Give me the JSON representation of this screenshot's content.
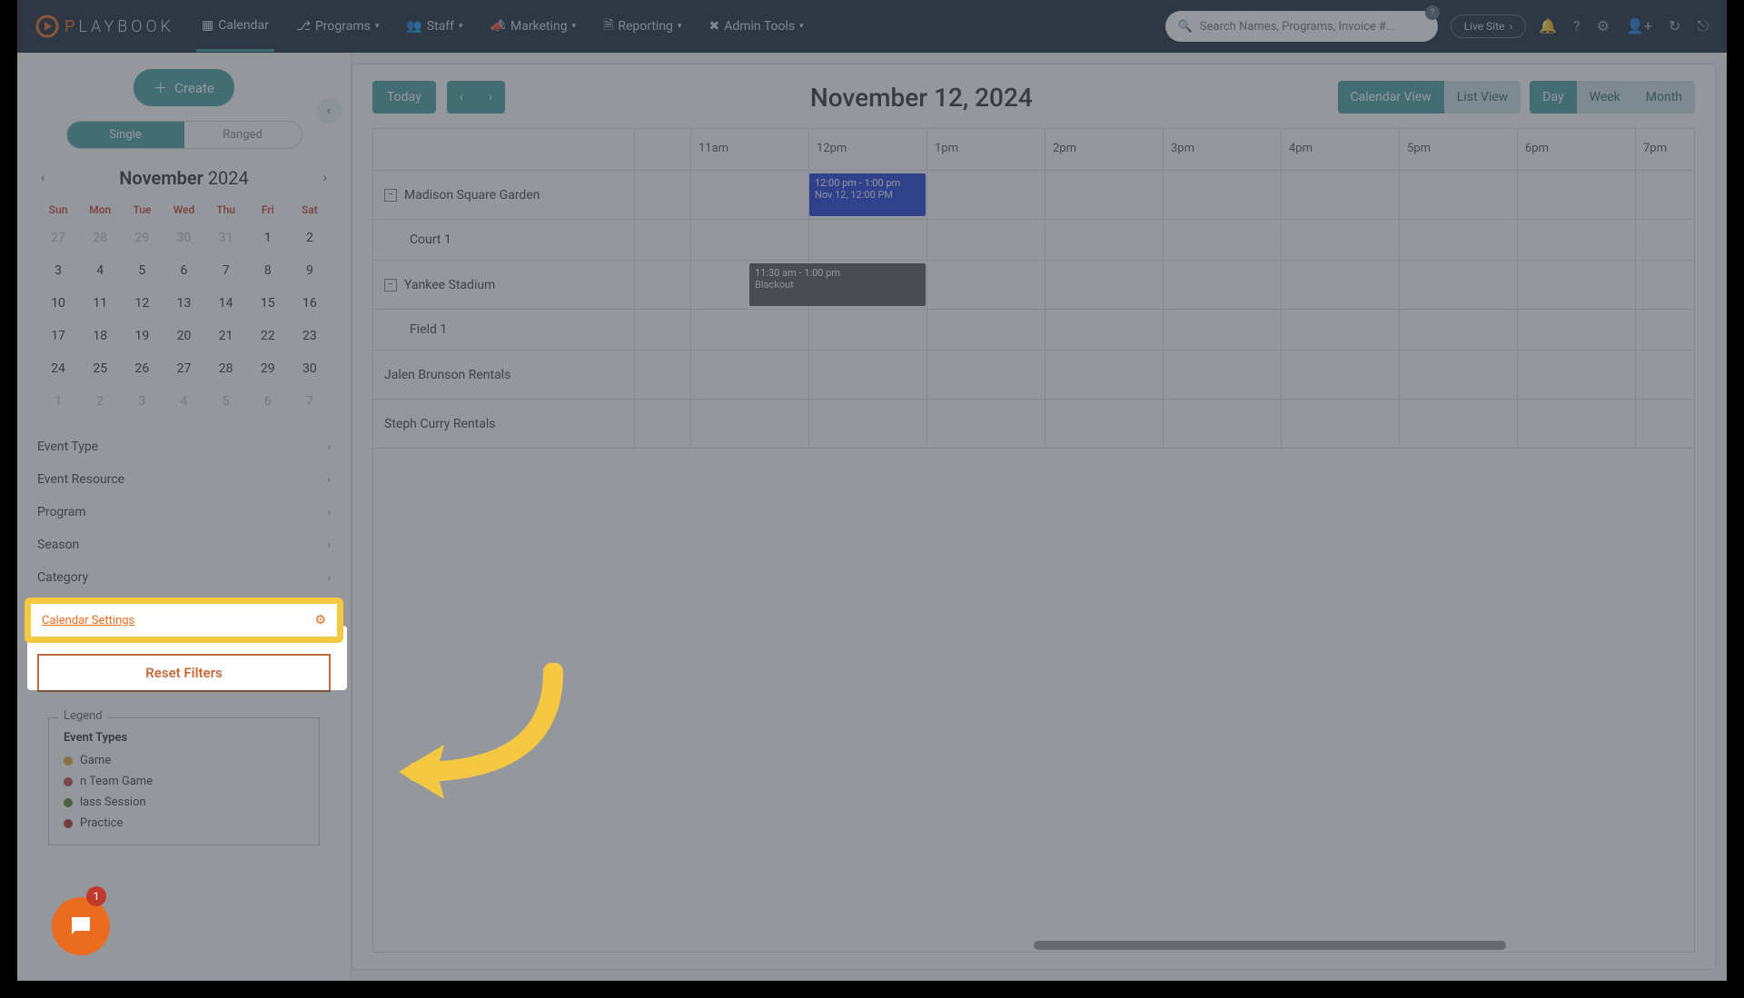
{
  "brand": {
    "name_part1": "P",
    "name_part2": "LAY",
    "name_part3": "BOOK"
  },
  "nav": {
    "calendar": "Calendar",
    "programs": "Programs",
    "staff": "Staff",
    "marketing": "Marketing",
    "reporting": "Reporting",
    "admin": "Admin Tools"
  },
  "search": {
    "placeholder": "Search Names, Programs, Invoice #..."
  },
  "live_site": "Live Site",
  "sidebar": {
    "create": "Create",
    "mode": {
      "single": "Single",
      "ranged": "Ranged"
    },
    "month_label_bold": "November",
    "month_label_year": " 2024",
    "dow": [
      "Sun",
      "Mon",
      "Tue",
      "Wed",
      "Thu",
      "Fri",
      "Sat"
    ],
    "weeks": [
      [
        "27",
        "28",
        "29",
        "30",
        "31",
        "1",
        "2"
      ],
      [
        "3",
        "4",
        "5",
        "6",
        "7",
        "8",
        "9"
      ],
      [
        "10",
        "11",
        "12",
        "13",
        "14",
        "15",
        "16"
      ],
      [
        "17",
        "18",
        "19",
        "20",
        "21",
        "22",
        "23"
      ],
      [
        "24",
        "25",
        "26",
        "27",
        "28",
        "29",
        "30"
      ],
      [
        "1",
        "2",
        "3",
        "4",
        "5",
        "6",
        "7"
      ]
    ],
    "selected_day": "13",
    "filters": [
      "Event Type",
      "Event Resource",
      "Program",
      "Season",
      "Category"
    ],
    "settings_link": "Calendar Settings",
    "reset": "Reset Filters",
    "legend_title": "Legend",
    "legend_h": "Event Types",
    "legend_items": [
      {
        "color": "#e8a23a",
        "label": "Game"
      },
      {
        "color": "#c94a3b",
        "label": "n Team Game"
      },
      {
        "color": "#5a8a3a",
        "label": "lass Session"
      },
      {
        "color": "#c0392b",
        "label": "Practice"
      }
    ]
  },
  "main": {
    "today": "Today",
    "date_title": "November 12, 2024",
    "view": {
      "calendar": "Calendar View",
      "list": "List View"
    },
    "period": {
      "day": "Day",
      "week": "Week",
      "month": "Month"
    },
    "hours": [
      "11am",
      "12pm",
      "1pm",
      "2pm",
      "3pm",
      "4pm",
      "5pm",
      "6pm",
      "7pm"
    ],
    "resources": [
      {
        "label": "Madison Square Garden",
        "collapsible": true
      },
      {
        "label": "Court 1",
        "sub": true
      },
      {
        "label": "Yankee Stadium",
        "collapsible": true
      },
      {
        "label": "Field 1",
        "sub": true
      },
      {
        "label": "Jalen Brunson Rentals"
      },
      {
        "label": "Steph Curry Rentals"
      }
    ],
    "events": {
      "msg": {
        "time": "12:00 pm - 1:00 pm",
        "detail": "Nov 12, 12:00 PM"
      },
      "yankee": {
        "time": "11:30 am - 1:00 pm",
        "detail": "Blackout"
      }
    }
  },
  "notif_count": "1"
}
